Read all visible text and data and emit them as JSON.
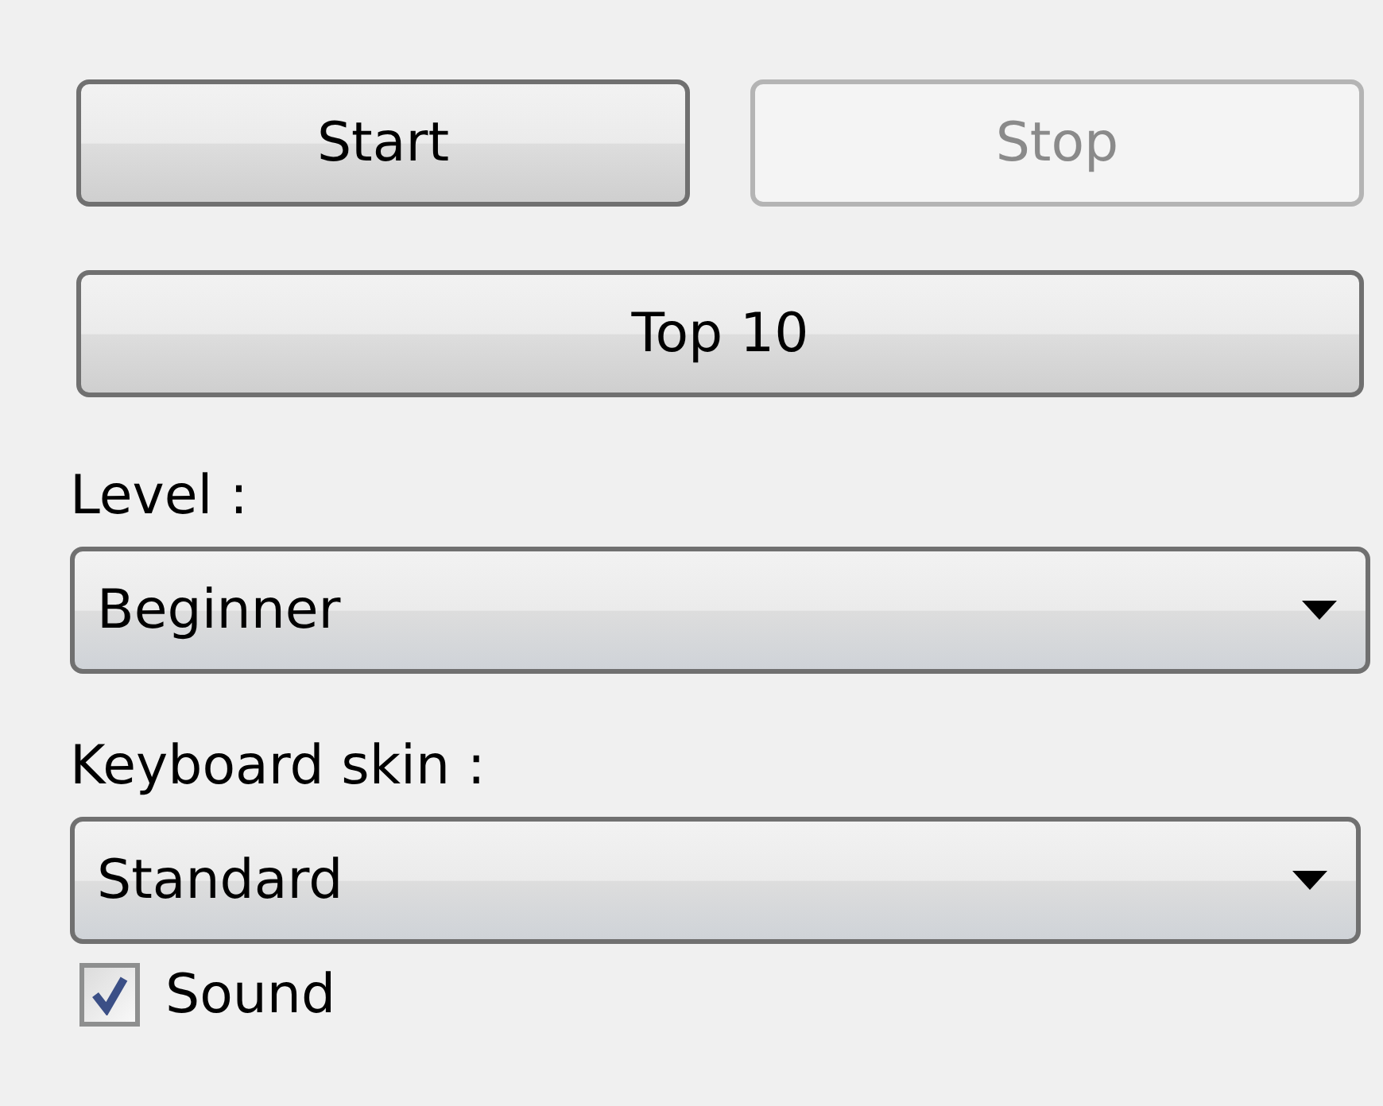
{
  "buttons": [
    {
      "label": "Start",
      "disabled": false
    },
    {
      "label": "Stop",
      "disabled": true
    }
  ],
  "top_button": {
    "label": "Top 10",
    "disabled": false
  },
  "level": {
    "label": "Level :",
    "value": "Beginner"
  },
  "keyboard_skin": {
    "label": "Keyboard skin :",
    "value": "Standard"
  },
  "sound": {
    "label": "Sound",
    "checked": true
  }
}
